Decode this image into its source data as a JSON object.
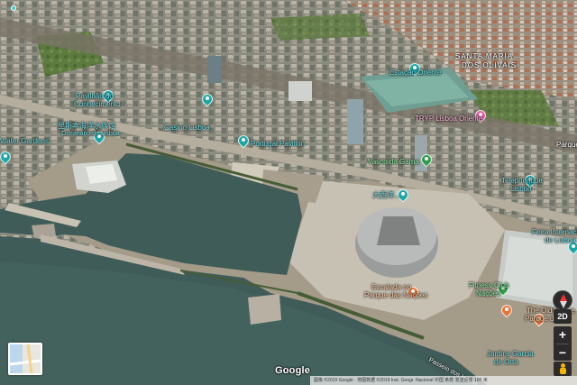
{
  "map": {
    "type": "satellite-3d",
    "location": "Parque das Nações, Lisbon"
  },
  "labels": {
    "santa_maria": "SANTA MARIA",
    "dos_olivais": "DOS OLIVAIS",
    "parque": "Parque",
    "gare": "Estação Oriente",
    "pavilion_knowledge_1": "Pavilhão do",
    "pavilion_knowledge_2": "Conhecimento",
    "oceanarium_cn": "里斯本海洋水族馆",
    "oceanarium": "Oceanário de Lisboa",
    "water_gardens": "Water Gardens",
    "casino": "Casino Lisboa",
    "portugal_pavilion": "Portugal Pavilion",
    "tryp": "TRYP Lisboa Oriente",
    "vasco_gama": "Vasco da Gama",
    "telepherique_1": "Telepherique",
    "telepherique_2": "Lisbon",
    "altice_cn": "大西洋...",
    "fil_1": "Feira Internacional",
    "fil_2": "de Lisboa",
    "climbing_1": "Escalada no",
    "climbing_2": "Parque das Nações",
    "garden_1": "Jardins Garcia",
    "garden_2": "de Orta",
    "old_house_1": "The Old House",
    "old_house_2": "Parque das...",
    "passeio": "Passeio dos Heróis do Mar",
    "fitness_1": "Fitness Club",
    "fitness_2": "Nações"
  },
  "controls": {
    "tilt_label": "2D",
    "zoom_in": "+",
    "zoom_out": "−"
  },
  "branding": {
    "logo": "Google",
    "attribution": "图像 ©2019 Google · 地图数据 ©2019 Inst. Geogr. Nacional  中国  条款  发送反馈  100 米"
  },
  "colors": {
    "water": "#3f5c58",
    "pin_teal": "#1aa7a8",
    "pin_pink": "#e4569f",
    "pin_green": "#2d9c4b",
    "pin_orange": "#e8763a"
  }
}
